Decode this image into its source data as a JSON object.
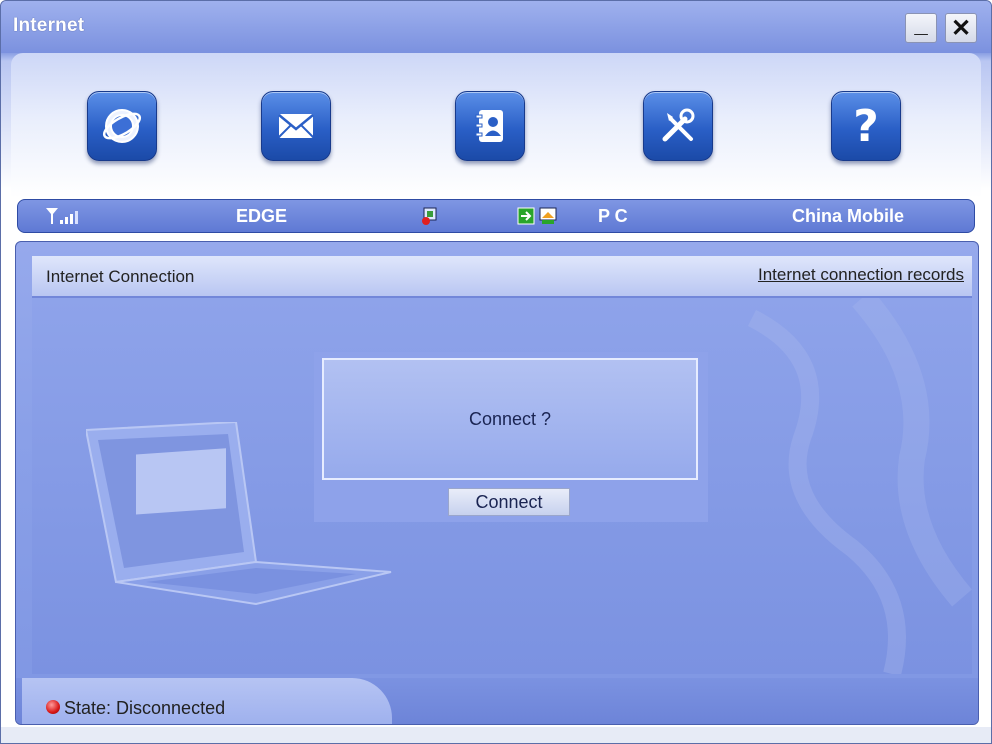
{
  "window": {
    "title": "Internet",
    "minimize_label": "_",
    "close_label": "✕"
  },
  "toolbar": [
    {
      "name": "internet-button",
      "icon": "globe-icon"
    },
    {
      "name": "messages-button",
      "icon": "envelope-icon"
    },
    {
      "name": "contacts-button",
      "icon": "address-book-icon"
    },
    {
      "name": "settings-button",
      "icon": "tools-icon"
    },
    {
      "name": "help-button",
      "icon": "question-icon",
      "glyph": "?"
    }
  ],
  "status": {
    "network_type": "EDGE",
    "mode": "P C",
    "operator": "China Mobile",
    "signal_icon": "signal-strength-icon",
    "sim_icon": "sim-card-icon",
    "pc_icon": "pc-connection-icon"
  },
  "panel": {
    "title": "Internet Connection",
    "records_link": "Internet connection records"
  },
  "dialog": {
    "message": "Connect ?",
    "button_label": "Connect"
  },
  "footer": {
    "state_text": "State: Disconnected",
    "state_color": "#d81818"
  }
}
